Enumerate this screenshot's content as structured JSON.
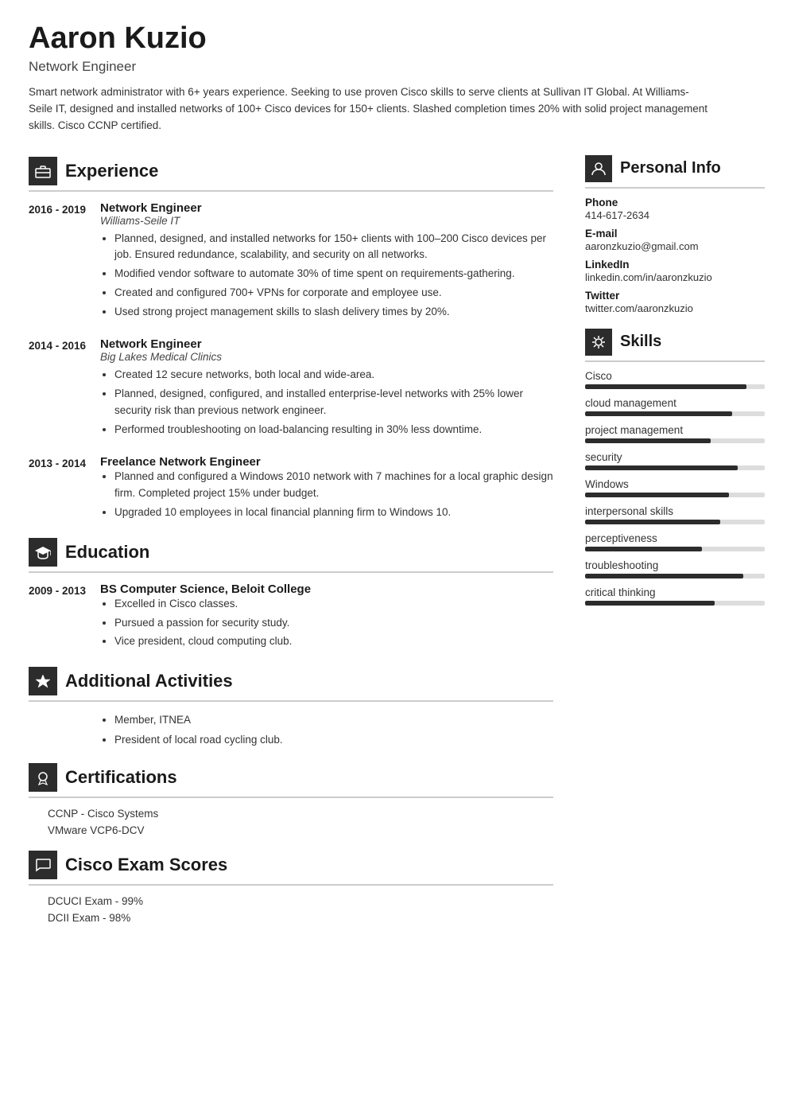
{
  "header": {
    "name": "Aaron Kuzio",
    "title": "Network Engineer",
    "summary": "Smart network administrator with 6+ years experience. Seeking to use proven Cisco skills to serve clients at Sullivan IT Global. At Williams-Seile IT, designed and installed networks of 100+ Cisco devices for 150+ clients. Slashed completion times 20% with solid project management skills. Cisco CCNP certified."
  },
  "left": {
    "experience_title": "Experience",
    "experience_entries": [
      {
        "date": "2016 - 2019",
        "job_title": "Network Engineer",
        "company": "Williams-Seile IT",
        "bullets": [
          "Planned, designed, and installed networks for 150+ clients with 100–200 Cisco devices per job. Ensured redundance, scalability, and security on all networks.",
          "Modified vendor software to automate 30% of time spent on requirements-gathering.",
          "Created and configured 700+ VPNs for corporate and employee use.",
          "Used strong project management skills to slash delivery times by 20%."
        ]
      },
      {
        "date": "2014 - 2016",
        "job_title": "Network Engineer",
        "company": "Big Lakes Medical Clinics",
        "bullets": [
          "Created 12 secure networks, both local and wide-area.",
          "Planned, designed, configured, and installed enterprise-level networks with 25% lower security risk than previous network engineer.",
          "Performed troubleshooting on load-balancing resulting in 30% less downtime."
        ]
      },
      {
        "date": "2013 - 2014",
        "job_title": "Freelance Network Engineer",
        "company": "",
        "bullets": [
          "Planned and configured a Windows 2010 network with 7 machines for a local graphic design firm. Completed project 15% under budget.",
          "Upgraded 10 employees in local financial planning firm to Windows 10."
        ]
      }
    ],
    "education_title": "Education",
    "education_entries": [
      {
        "date": "2009 - 2013",
        "degree": "BS Computer Science, Beloit College",
        "company": "",
        "bullets": [
          "Excelled in Cisco classes.",
          "Pursued a passion for security study.",
          "Vice president, cloud computing club."
        ]
      }
    ],
    "additional_title": "Additional Activities",
    "additional_bullets": [
      "Member, ITNEA",
      "President of local road cycling club."
    ],
    "certifications_title": "Certifications",
    "certifications": [
      "CCNP - Cisco Systems",
      "VMware VCP6-DCV"
    ],
    "exam_title": "Cisco Exam Scores",
    "exams": [
      "DCUCI Exam - 99%",
      "DCII Exam - 98%"
    ]
  },
  "right": {
    "personal_title": "Personal Info",
    "phone_label": "Phone",
    "phone": "414-617-2634",
    "email_label": "E-mail",
    "email": "aaronzkuzio@gmail.com",
    "linkedin_label": "LinkedIn",
    "linkedin": "linkedin.com/in/aaronzkuzio",
    "twitter_label": "Twitter",
    "twitter": "twitter.com/aaronzkuzio",
    "skills_title": "Skills",
    "skills": [
      {
        "name": "Cisco",
        "pct": 90
      },
      {
        "name": "cloud management",
        "pct": 82
      },
      {
        "name": "project management",
        "pct": 70
      },
      {
        "name": "security",
        "pct": 85
      },
      {
        "name": "Windows",
        "pct": 80
      },
      {
        "name": "interpersonal skills",
        "pct": 75
      },
      {
        "name": "perceptiveness",
        "pct": 65
      },
      {
        "name": "troubleshooting",
        "pct": 88
      },
      {
        "name": "critical thinking",
        "pct": 72
      }
    ]
  },
  "icons": {
    "briefcase": "🗂",
    "graduation": "🎓",
    "star": "★",
    "award": "🏅",
    "chat": "💬",
    "person": "👤",
    "skills": "🔧"
  }
}
